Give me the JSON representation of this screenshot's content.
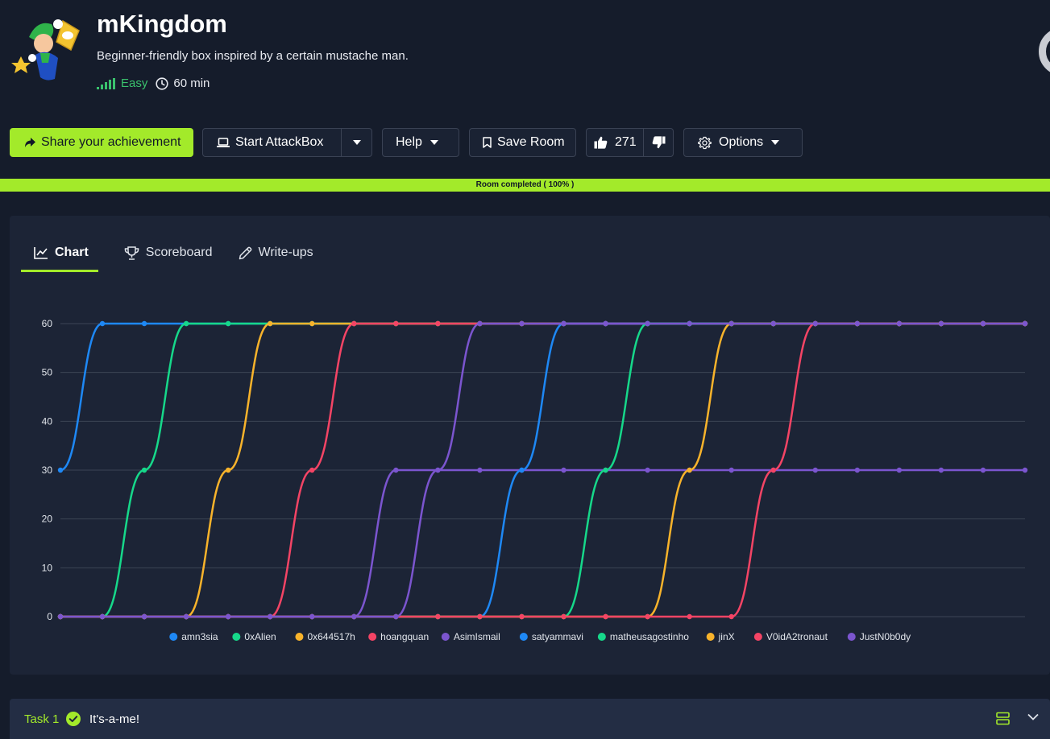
{
  "room": {
    "title": "mKingdom",
    "description": "Beginner-friendly box inspired by a certain mustache man.",
    "difficulty": "Easy",
    "duration": "60 min"
  },
  "toolbar": {
    "share_label": "Share your achievement",
    "attackbox_label": "Start AttackBox",
    "help_label": "Help",
    "save_label": "Save Room",
    "upvotes": "271",
    "options_label": "Options"
  },
  "progress": {
    "label": "Room completed ( 100% )",
    "percent": 100
  },
  "tabs": [
    {
      "label": "Chart",
      "active": true
    },
    {
      "label": "Scoreboard",
      "active": false
    },
    {
      "label": "Write-ups",
      "active": false
    }
  ],
  "task": {
    "number": "Task 1",
    "title": "It's-a-me!"
  },
  "colors": {
    "accent": "#a3ea2a",
    "easy": "#3ac26d"
  },
  "chart_data": {
    "type": "line",
    "x": [
      0,
      1,
      2,
      3,
      4,
      5,
      6,
      7,
      8,
      9,
      10,
      11,
      12,
      13,
      14,
      15,
      16,
      17,
      18,
      19,
      20,
      21,
      22,
      23
    ],
    "ylim": [
      0,
      60
    ],
    "yticks": [
      "0",
      "10",
      "20",
      "30",
      "40",
      "50",
      "60"
    ],
    "grid": true,
    "legend_position": "bottom",
    "series": [
      {
        "name": "amn3sia",
        "color": "#1e88f5",
        "values": [
          30,
          60,
          60,
          60,
          60,
          60,
          60,
          60,
          60,
          60,
          60,
          60,
          60,
          60,
          60,
          60,
          60,
          60,
          60,
          60,
          60,
          60,
          60,
          60
        ]
      },
      {
        "name": "0xAlien",
        "color": "#16d88a",
        "values": [
          0,
          0,
          30,
          60,
          60,
          60,
          60,
          60,
          60,
          60,
          60,
          60,
          60,
          60,
          60,
          60,
          60,
          60,
          60,
          60,
          60,
          60,
          60,
          60
        ]
      },
      {
        "name": "0x644517h",
        "color": "#f8b32b",
        "values": [
          0,
          0,
          0,
          0,
          30,
          60,
          60,
          60,
          60,
          60,
          60,
          60,
          60,
          60,
          60,
          60,
          60,
          60,
          60,
          60,
          60,
          60,
          60,
          60
        ]
      },
      {
        "name": "hoangquan",
        "color": "#f44465",
        "values": [
          0,
          0,
          0,
          0,
          0,
          0,
          30,
          60,
          60,
          60,
          60,
          60,
          60,
          60,
          60,
          60,
          60,
          60,
          60,
          60,
          60,
          60,
          60,
          60
        ]
      },
      {
        "name": "AsimIsmail",
        "color": "#7b55cf",
        "values": [
          0,
          0,
          0,
          0,
          0,
          0,
          0,
          0,
          30,
          30,
          30,
          30,
          30,
          30,
          30,
          30,
          30,
          30,
          30,
          30,
          30,
          30,
          30,
          30
        ]
      },
      {
        "name": "satyammavi",
        "color": "#1e88f5",
        "values": [
          0,
          0,
          0,
          0,
          0,
          0,
          0,
          0,
          0,
          0,
          0,
          30,
          60,
          60,
          60,
          60,
          60,
          60,
          60,
          60,
          60,
          60,
          60,
          60
        ]
      },
      {
        "name": "matheusagostinho",
        "color": "#16d88a",
        "values": [
          0,
          0,
          0,
          0,
          0,
          0,
          0,
          0,
          0,
          0,
          0,
          0,
          0,
          30,
          60,
          60,
          60,
          60,
          60,
          60,
          60,
          60,
          60,
          60
        ]
      },
      {
        "name": "jinX",
        "color": "#f8b32b",
        "values": [
          0,
          0,
          0,
          0,
          0,
          0,
          0,
          0,
          0,
          0,
          0,
          0,
          0,
          0,
          0,
          30,
          60,
          60,
          60,
          60,
          60,
          60,
          60,
          60
        ]
      },
      {
        "name": "V0idA2tronaut",
        "color": "#f44465",
        "values": [
          0,
          0,
          0,
          0,
          0,
          0,
          0,
          0,
          0,
          0,
          0,
          0,
          0,
          0,
          0,
          0,
          0,
          30,
          60,
          60,
          60,
          60,
          60,
          60
        ]
      },
      {
        "name": "JustN0b0dy",
        "color": "#7b55cf",
        "values": [
          0,
          0,
          0,
          0,
          0,
          0,
          0,
          0,
          0,
          30,
          60,
          60,
          60,
          60,
          60,
          60,
          60,
          60,
          60,
          60,
          60,
          60,
          60,
          60
        ]
      }
    ]
  }
}
